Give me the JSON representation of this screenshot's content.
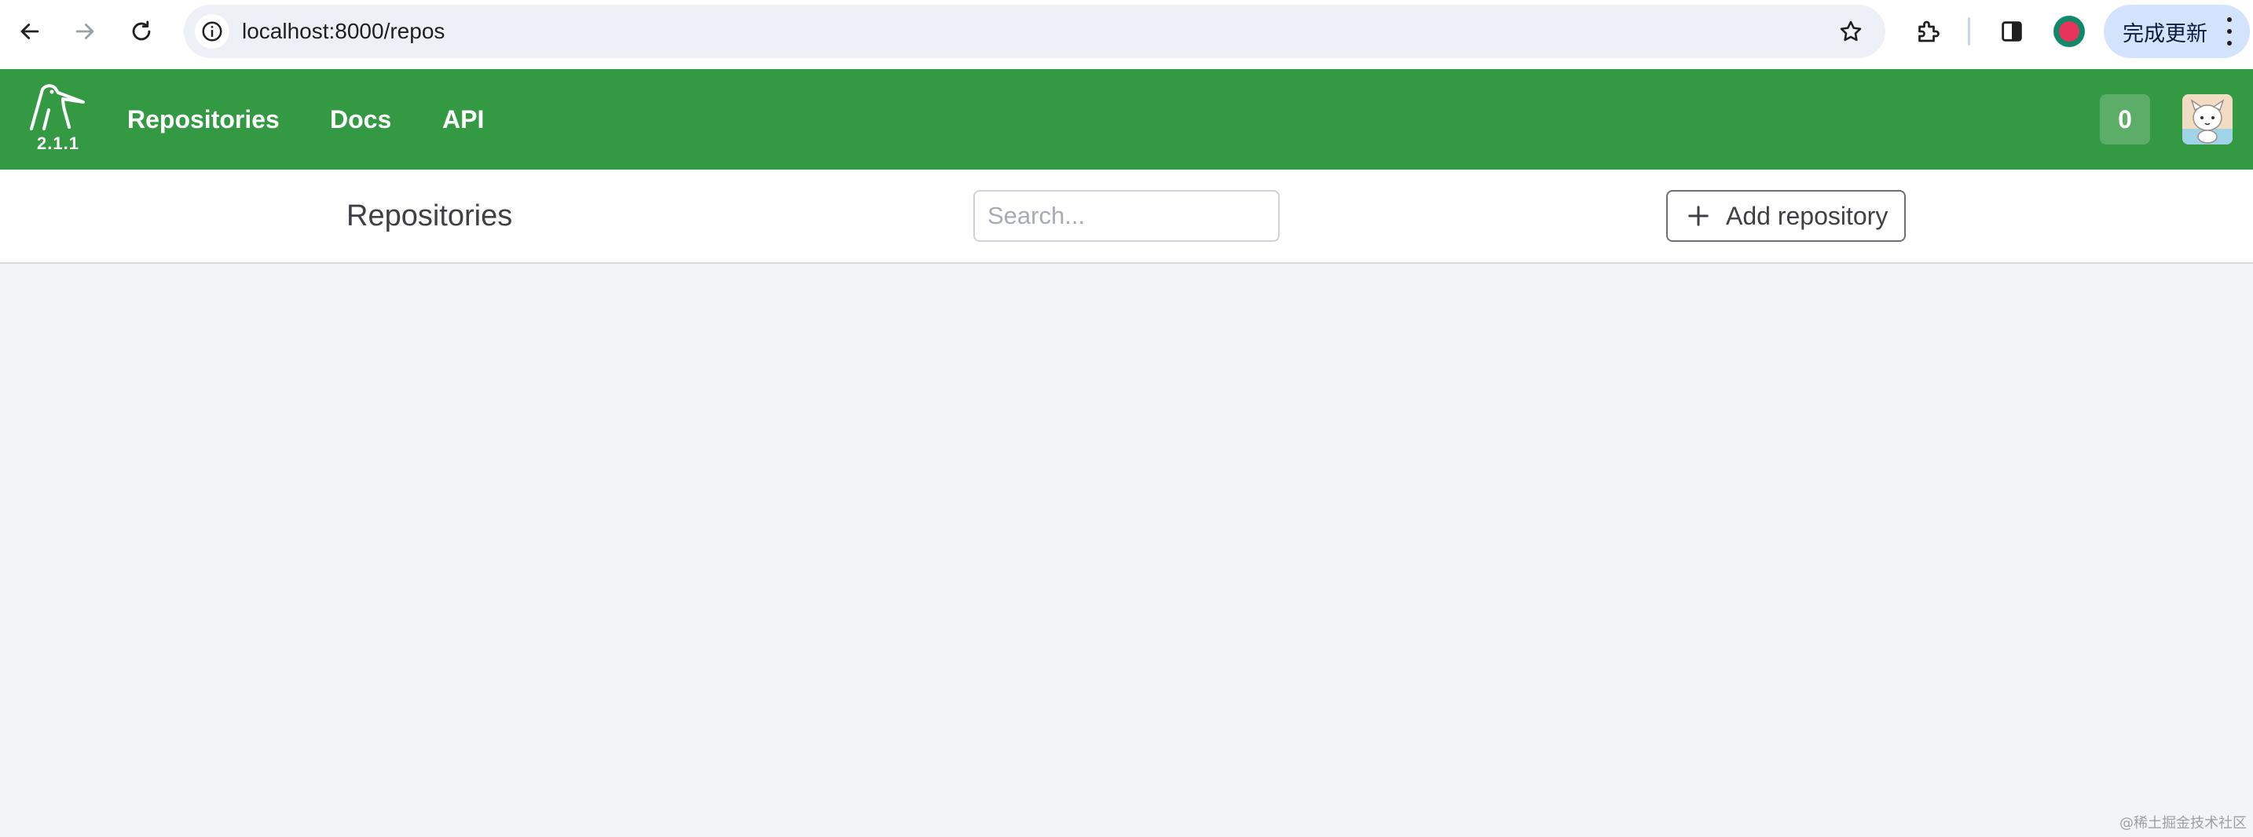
{
  "browser": {
    "url": "localhost:8000/repos",
    "update_label": "完成更新"
  },
  "header": {
    "version": "2.1.1",
    "nav": [
      {
        "label": "Repositories"
      },
      {
        "label": "Docs"
      },
      {
        "label": "API"
      }
    ],
    "badge_count": "0"
  },
  "page": {
    "title": "Repositories",
    "search_placeholder": "Search...",
    "add_label": "Add repository"
  },
  "watermark": "@稀土掘金技术社区",
  "colors": {
    "header_green": "#339943",
    "page_background": "#f3f4f6"
  }
}
